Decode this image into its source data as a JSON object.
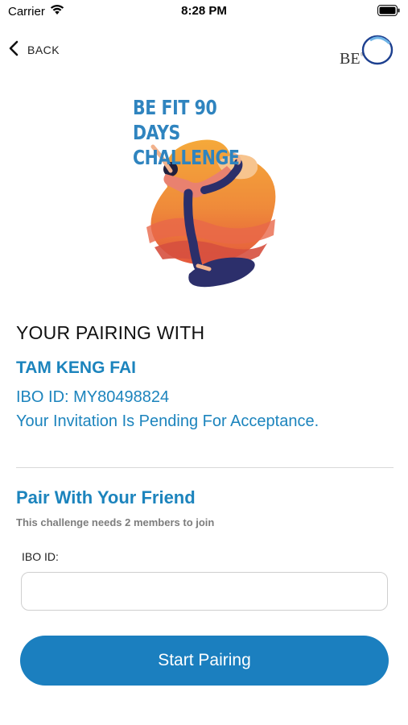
{
  "status_bar": {
    "carrier": "Carrier",
    "time": "8:28 PM",
    "wifi_icon": "wifi-icon",
    "battery_icon": "battery-icon"
  },
  "nav": {
    "back_label": "BACK",
    "back_icon": "chevron-left-icon",
    "brand_logo_text": "BE"
  },
  "hero": {
    "title_line1": "BE FIT 90 DAYS",
    "title_line2": "CHALLENGE"
  },
  "pairing": {
    "heading": "YOUR PAIRING WITH",
    "partner_name": "TAM KENG FAI",
    "partner_ibo": "IBO ID: MY80498824",
    "status": "Your Invitation Is Pending For Acceptance."
  },
  "pair_friend": {
    "title": "Pair With Your Friend",
    "subtitle": "This challenge needs 2 members to join",
    "ibo_label": "IBO ID:",
    "ibo_value": "",
    "button_label": "Start Pairing"
  },
  "colors": {
    "accent": "#1c84bd",
    "button": "#1b7fbf",
    "hero_title": "#2f84bf"
  }
}
